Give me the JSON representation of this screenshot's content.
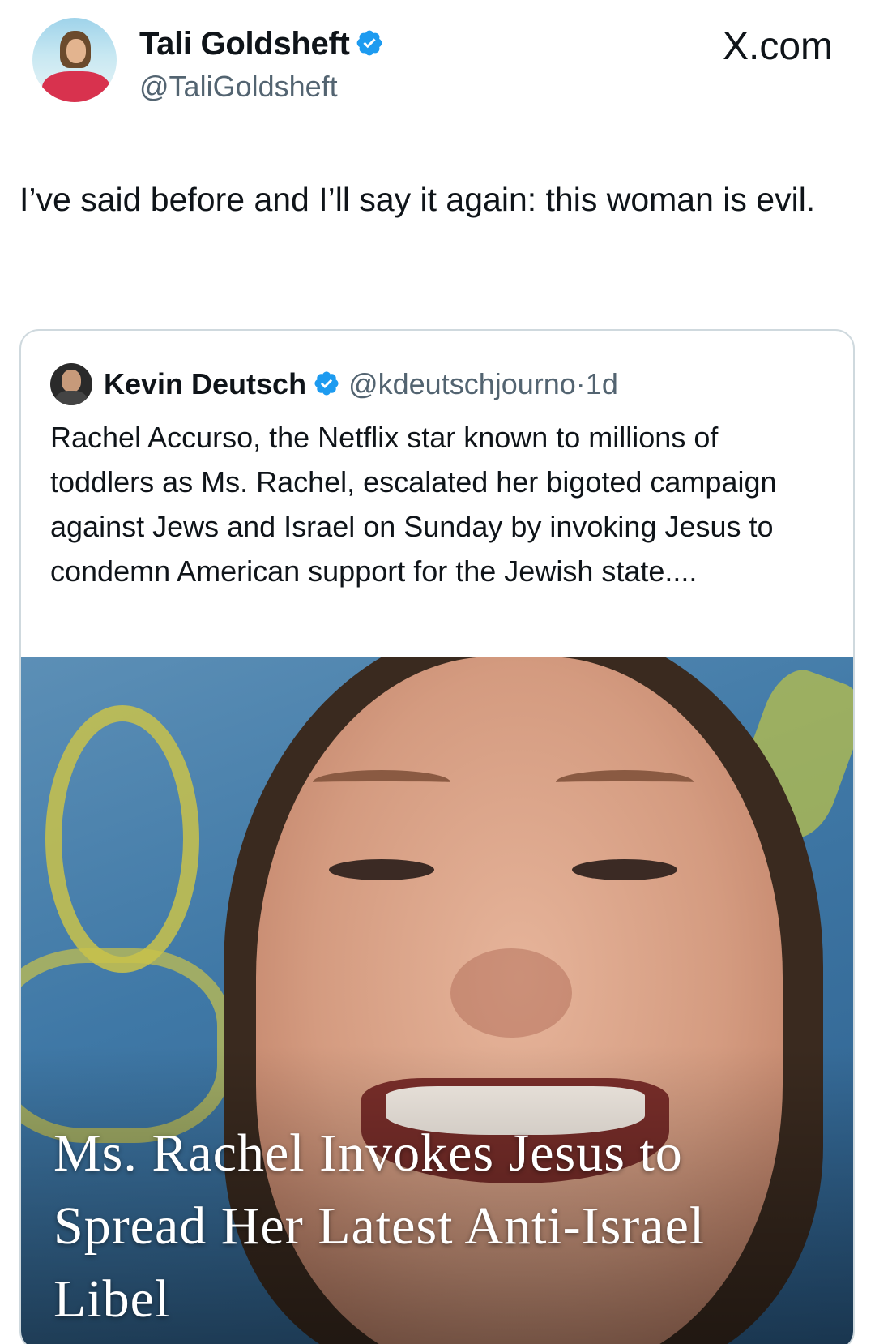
{
  "author": {
    "name": "Tali Goldsheft",
    "handle": "@TaliGoldsheft",
    "verified_icon": "verified-badge-icon"
  },
  "site_label": "X.com",
  "tweet": {
    "text": "I’ve said before and I’ll say it again: this woman is evil."
  },
  "quoted_tweet": {
    "author_name": "Kevin Deutsch",
    "author_handle": "@kdeutschjourno",
    "separator": "·",
    "time": "1d",
    "text": "Rachel Accurso, the Netflix star known to millions of toddlers as Ms. Rachel, escalated her bigoted campaign against Jews and Israel on Sunday by invoking Jesus to condemn American support for the Jewish state....",
    "image_headline": "Ms. Rachel Invokes Jesus to Spread Her Latest Anti-Israel Libel"
  },
  "colors": {
    "verified_blue": "#1d9bf0",
    "secondary_text": "#536471",
    "card_border": "#cfd9de"
  }
}
